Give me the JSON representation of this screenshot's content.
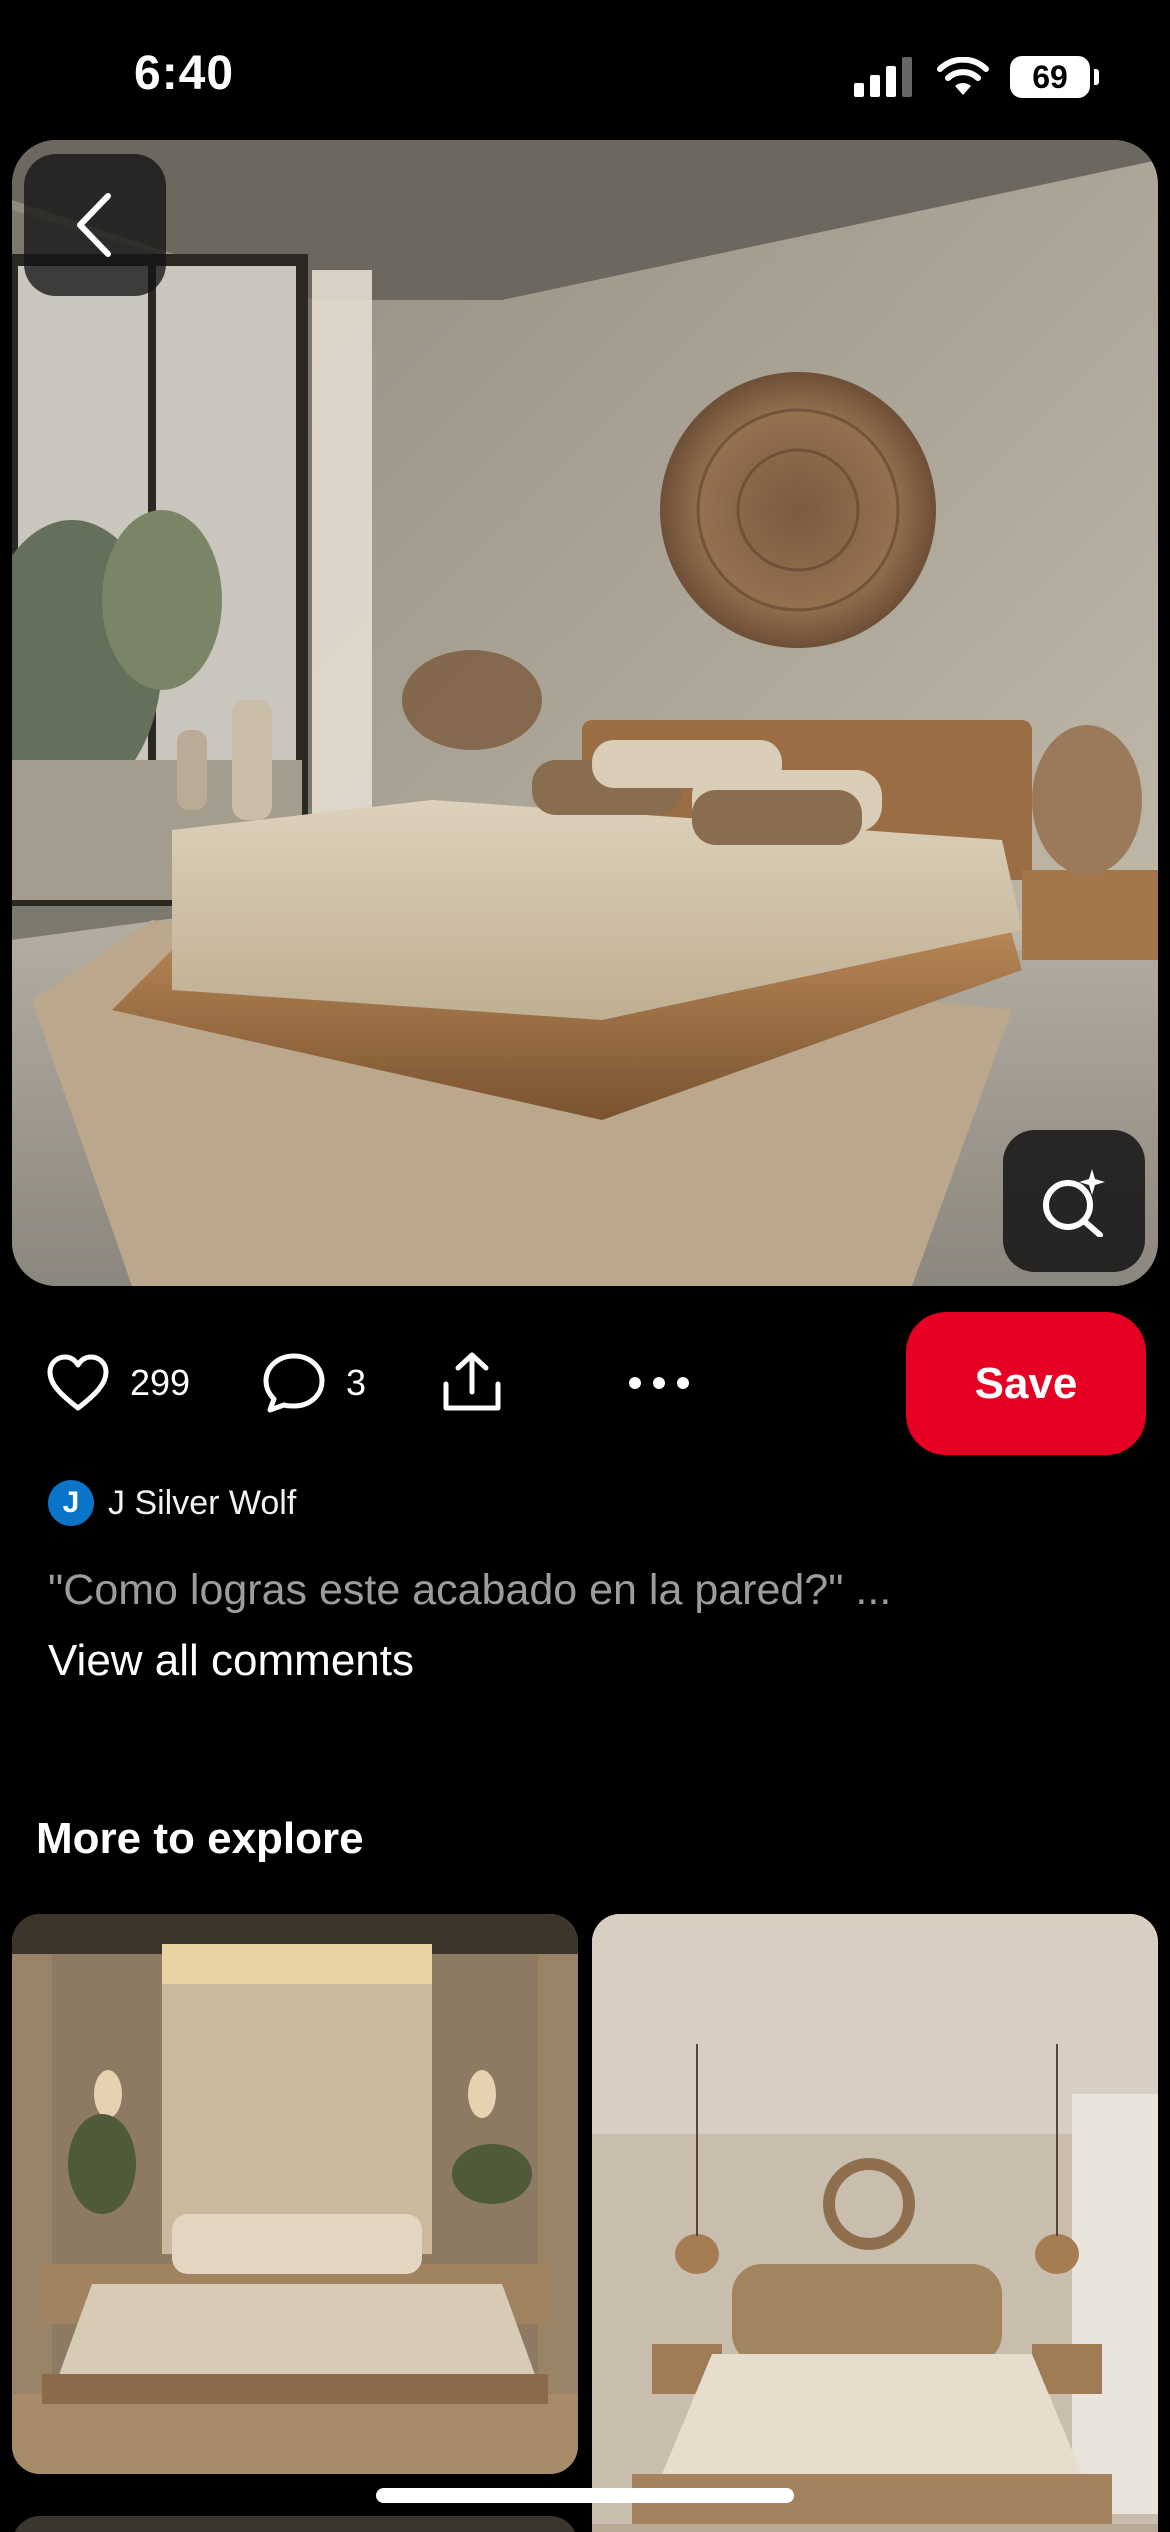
{
  "status_bar": {
    "time": "6:40",
    "battery": "69"
  },
  "pin": {
    "likes": "299",
    "comments": "3",
    "save_label": "Save"
  },
  "comment": {
    "avatar_letter": "J",
    "author": "J Silver Wolf",
    "text": "\"Como logras este acabado en la pared?\" ...",
    "view_all": "View all comments"
  },
  "explore": {
    "title": "More to explore"
  },
  "icons": {
    "back": "chevron-left-icon",
    "visual_search": "sparkle-search-icon",
    "like": "heart-icon",
    "comment": "comment-bubble-icon",
    "share": "share-upload-icon",
    "more": "more-dots-icon"
  },
  "colors": {
    "save": "#e60023",
    "avatar": "#0a74c9",
    "background": "#000000"
  }
}
